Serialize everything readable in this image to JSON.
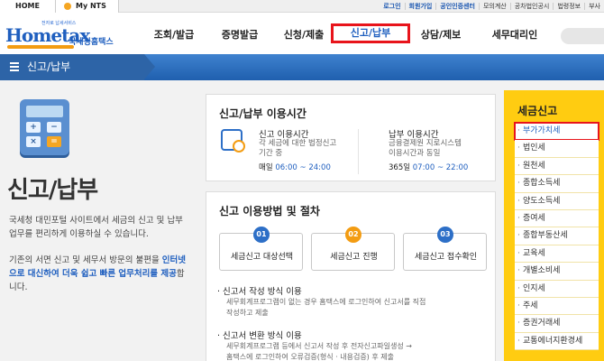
{
  "topbar": {
    "home": "HOME",
    "my_nts": "My NTS",
    "links": [
      "로그인",
      "회원가입",
      "공인인증센터",
      "모의계산",
      "공차법인공시",
      "법령정보",
      "부사"
    ]
  },
  "logo": {
    "sub": "전자로 납세서비스",
    "main": "Hometax",
    "name": "국세청홈택스"
  },
  "gnb": [
    "조회/발급",
    "증명발급",
    "신청/제출",
    "신고/납부",
    "상담/제보",
    "세무대리인"
  ],
  "section_bar": {
    "title": "신고/납부"
  },
  "intro": {
    "title": "신고/납부",
    "para1": "국세청 대민포털 사이트에서 세금의 신고 및 납부 업무를 편리하게 이용하실 수 있습니다.",
    "para2_pre": "기존의 서면 신고 및 세무서 방문의 불편을",
    "para2_hl": "인터넷으로 대신하여 더욱 쉽고 빠른 업무처리를 제공",
    "para2_post": "합니다."
  },
  "hours_panel": {
    "title": "신고/납부 이용시간",
    "left": {
      "label": "신고 이용시간",
      "desc1": "각 세금에 대한 법정신고",
      "desc2": "기간 중",
      "day": "매일",
      "time": "06:00 ~ 24:00"
    },
    "right": {
      "label": "납부 이용시간",
      "desc1": "금융결제원 지로시스템",
      "desc2": "이용시간과 동일",
      "day": "365일",
      "time": "07:00 ~ 22:00"
    }
  },
  "method_panel": {
    "title": "신고 이용방법 및 절차",
    "steps": [
      {
        "num": "01",
        "label": "세금신고 대상선택",
        "color": "#2d6fc7"
      },
      {
        "num": "02",
        "label": "세금신고 진행",
        "color": "#f39c12"
      },
      {
        "num": "03",
        "label": "세금신고 접수확인",
        "color": "#2d6fc7"
      }
    ],
    "m1_title": "신고서 작성 방식 이용",
    "m1_desc1": "세무회계프로그램이 없는 경우 홈택스에 로그인하여 신고서를 직접",
    "m1_desc2": "작성하고 제출",
    "m2_title": "신고서 변환 방식 이용",
    "m2_desc1": "세무회계프로그램 등에서 신고서 작성 후 전자신고파일생성 →",
    "m2_desc2": "홈택스에 로그인하여 오류검증(형식 · 내용검증) 후 제출"
  },
  "tax_menu": {
    "title": "세금신고",
    "items": [
      "부가가치세",
      "법인세",
      "원천세",
      "종합소득세",
      "양도소득세",
      "증여세",
      "종합부동산세",
      "교육세",
      "개별소비세",
      "인지세",
      "주세",
      "증권거래세",
      "교통에너지환경세"
    ],
    "active_index": 0
  }
}
